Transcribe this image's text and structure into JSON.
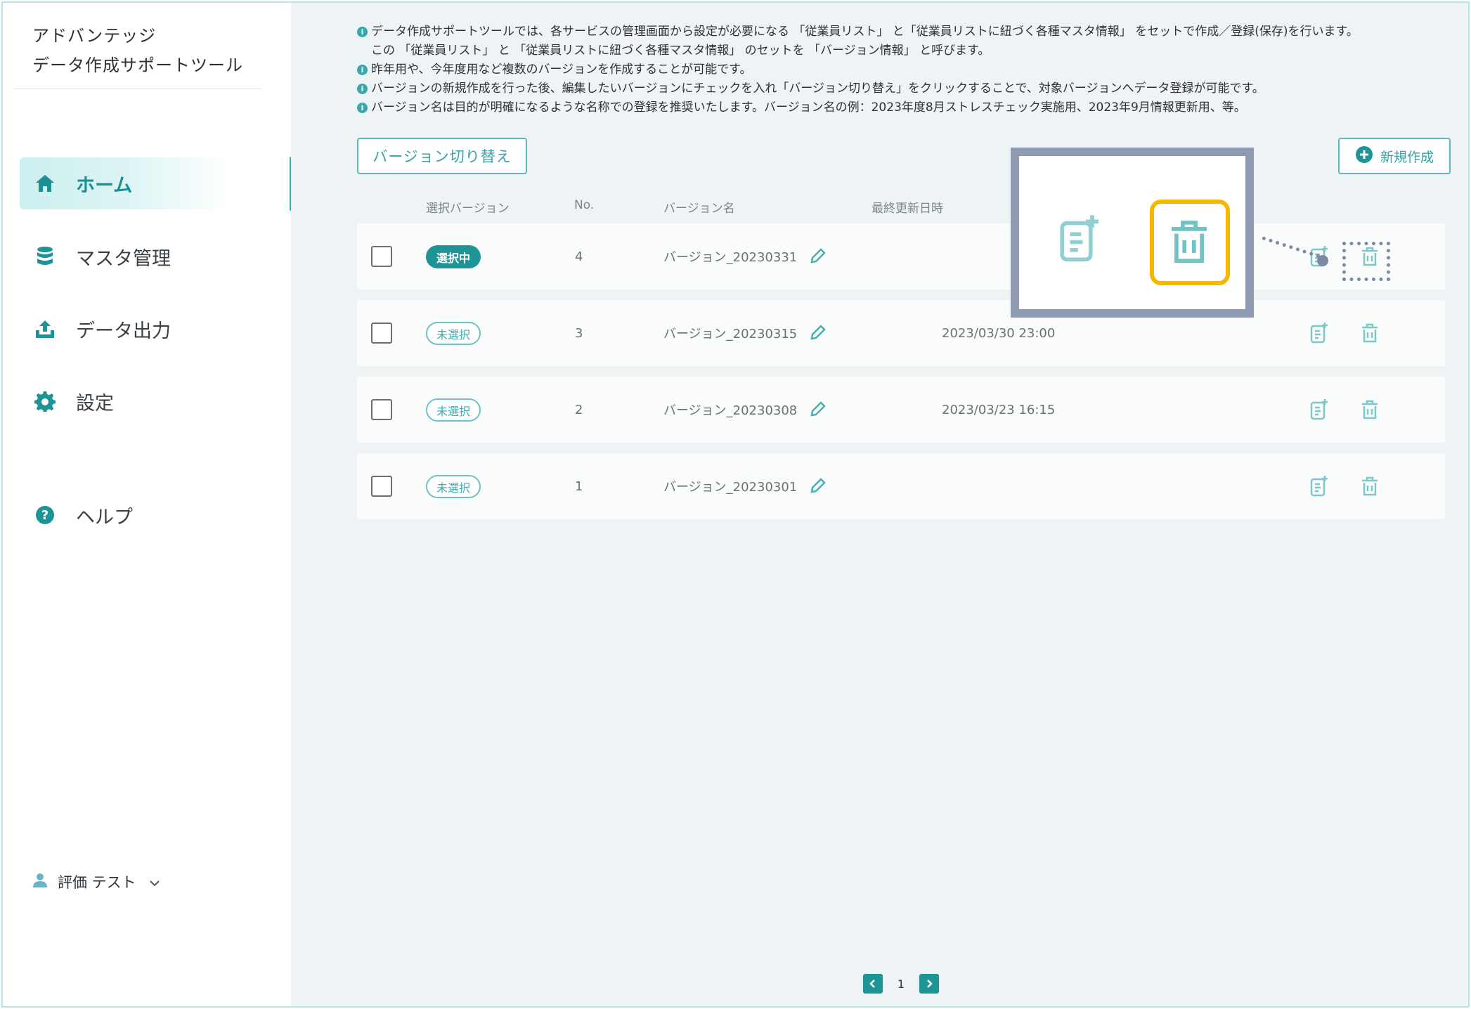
{
  "app": {
    "title_line1": "アドバンテッジ",
    "title_line2": "データ作成サポートツール"
  },
  "sidebar": {
    "items": [
      {
        "label": "ホーム",
        "icon": "home-icon",
        "active": true
      },
      {
        "label": "マスタ管理",
        "icon": "database-icon"
      },
      {
        "label": "データ出力",
        "icon": "upload-icon"
      },
      {
        "label": "設定",
        "icon": "gear-icon"
      },
      {
        "label": "ヘルプ",
        "icon": "help-icon"
      }
    ],
    "user": {
      "name": "評価 テスト"
    }
  },
  "notes": [
    "データ作成サポートツールでは、各サービスの管理画面から設定が必要になる 「従業員リスト」 と「従業員リストに紐づく各種マスタ情報」 をセットで作成／登録(保存)を行います。",
    "この 「従業員リスト」 と 「従業員リストに紐づく各種マスタ情報」 のセットを 「バージョン情報」 と呼びます。",
    "昨年用や、今年度用など複数のバージョンを作成することが可能です。",
    "バージョンの新規作成を行った後、編集したいバージョンにチェックを入れ「バージョン切り替え」をクリックすることで、対象バージョンへデータ登録が可能です。",
    "バージョン名は目的が明確になるような名称での登録を推奨いたします。バージョン名の例：2023年度8月ストレスチェック実施用、2023年9月情報更新用、等。"
  ],
  "toolbar": {
    "switch_label": "バージョン切り替え",
    "new_label": "新規作成"
  },
  "table": {
    "headers": {
      "selected": "選択バージョン",
      "no": "No.",
      "name": "バージョン名",
      "updated": "最終更新日時"
    },
    "rows": [
      {
        "status": "選択中",
        "selected": true,
        "no": "4",
        "name": "バージョン_20230331",
        "updated": ""
      },
      {
        "status": "未選択",
        "selected": false,
        "no": "3",
        "name": "バージョン_20230315",
        "updated": "2023/03/30 23:00"
      },
      {
        "status": "未選択",
        "selected": false,
        "no": "2",
        "name": "バージョン_20230308",
        "updated": "2023/03/23 16:15"
      },
      {
        "status": "未選択",
        "selected": false,
        "no": "1",
        "name": "バージョン_20230301",
        "updated": ""
      }
    ]
  },
  "pagination": {
    "current": "1"
  },
  "colors": {
    "accent": "#1e9497",
    "highlight": "#f5b800",
    "callout": "#8f9bb2"
  }
}
